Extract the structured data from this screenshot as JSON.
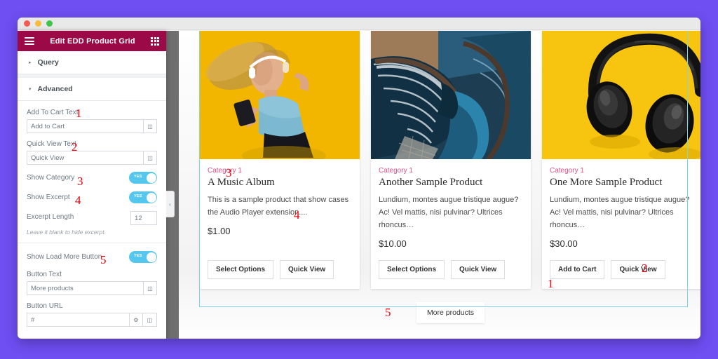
{
  "window": {
    "traffic_lights": [
      "close",
      "minimize",
      "maximize"
    ]
  },
  "panel": {
    "header": {
      "title": "Edit EDD Product Grid",
      "menu_icon": "hamburger-icon",
      "apps_icon": "grid-apps-icon"
    },
    "sections": [
      {
        "label": "Query",
        "expanded": false,
        "arrow": "▸"
      },
      {
        "label": "Advanced",
        "expanded": true,
        "arrow": "▾"
      }
    ],
    "fields": {
      "add_to_cart_text": {
        "label": "Add To Cart Text",
        "value": "Add to Cart",
        "annotation": "1"
      },
      "quick_view_text": {
        "label": "Quick View Text",
        "value": "Quick View",
        "annotation": "2"
      },
      "show_category": {
        "label": "Show Category",
        "state": "YES",
        "annotation": "3"
      },
      "show_excerpt": {
        "label": "Show Excerpt",
        "state": "YES",
        "annotation": "4"
      },
      "excerpt_length": {
        "label": "Excerpt Length",
        "value": "12",
        "hint": "Leave it blank to hide excerpt."
      },
      "show_load_more": {
        "label": "Show Load More Button",
        "state": "YES",
        "annotation": "5"
      },
      "button_text": {
        "label": "Button Text",
        "value": "More products"
      },
      "button_url": {
        "label": "Button URL",
        "value": "#"
      }
    },
    "collapse_handle": "‹"
  },
  "preview": {
    "products": [
      {
        "image": "woman-with-headphones-photo",
        "image_style": "yellow",
        "category": "Category 1",
        "title": "A Music Album",
        "excerpt": "This is a sample product that show cases the Audio Player extension....",
        "price": "$1.00",
        "primary_button": "Select Options",
        "secondary_button": "Quick View"
      },
      {
        "image": "spiral-staircase-photo",
        "image_style": "stairs",
        "category": "Category 1",
        "title": "Another Sample Product",
        "excerpt": "Lundium, montes augue tristique augue? Ac! Vel mattis, nisi pulvinar? Ultrices rhoncus…",
        "price": "$10.00",
        "primary_button": "Select Options",
        "secondary_button": "Quick View"
      },
      {
        "image": "black-headphones-photo",
        "image_style": "headphones",
        "category": "Category 1",
        "title": "One More Sample Product",
        "excerpt": "Lundium, montes augue tristique augue? Ac! Vel mattis, nisi pulvinar? Ultrices rhoncus…",
        "price": "$30.00",
        "primary_button": "Add to Cart",
        "secondary_button": "Quick View"
      }
    ],
    "load_more_button": "More products",
    "annotations": {
      "category": "3",
      "excerpt": "4",
      "add_to_cart": "1",
      "quick_view": "2",
      "load_more": "5"
    }
  },
  "colors": {
    "page_background": "#6f4ef2",
    "panel_header": "#9b0a46",
    "toggle_on": "#55c7ee",
    "category_text": "#e0527f",
    "selection_border": "#7fd4ea",
    "annotation_red": "#e8000d"
  }
}
